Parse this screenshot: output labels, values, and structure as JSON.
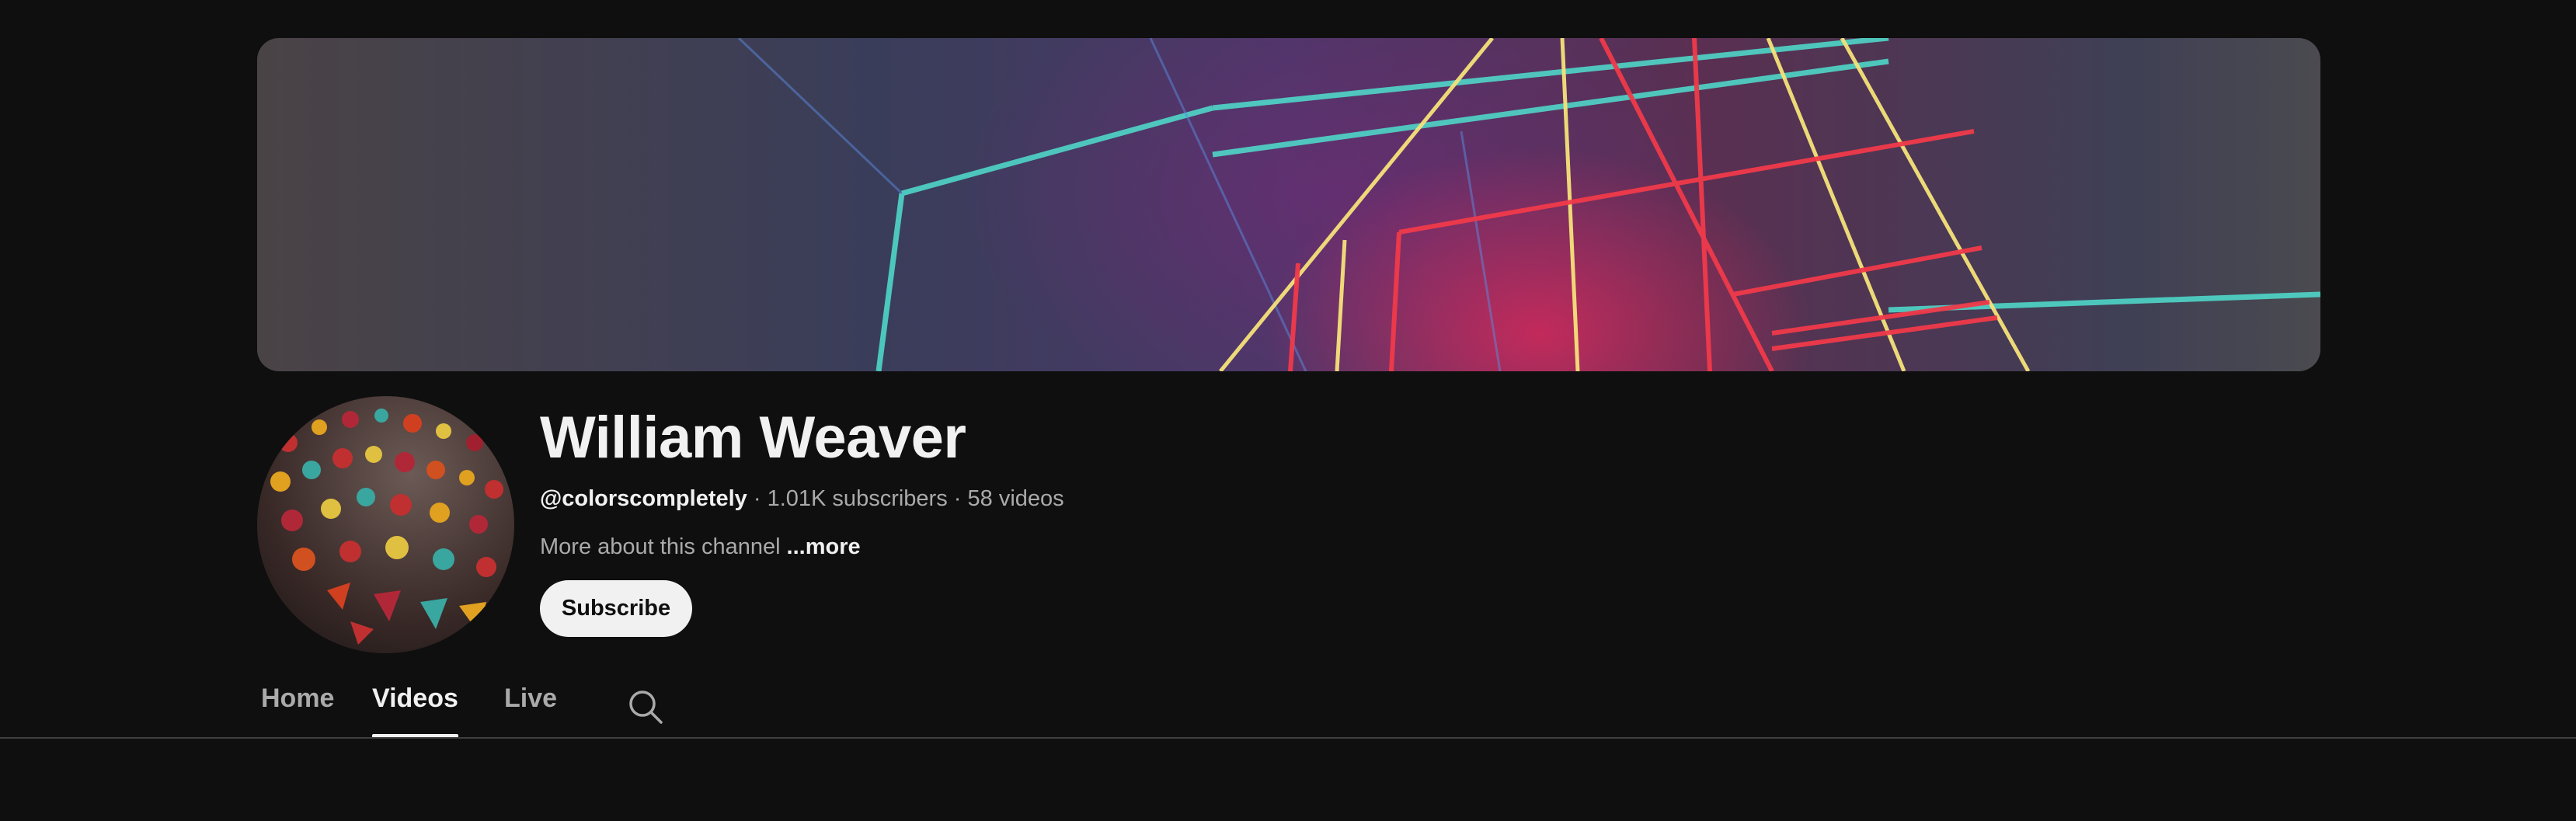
{
  "channel": {
    "name": "William Weaver",
    "handle": "@colorscompletely",
    "separator": " · ",
    "subscribers": "1.01K subscribers",
    "videos": "58 videos",
    "description": "More about this channel",
    "more_label": "...more",
    "subscribe_label": "Subscribe"
  },
  "tabs": [
    {
      "label": "Home",
      "active": false
    },
    {
      "label": "Videos",
      "active": true
    },
    {
      "label": "Live",
      "active": false
    }
  ],
  "icons": {
    "search": "search-icon"
  },
  "colors": {
    "background": "#0f0f0f",
    "text_primary": "#f1f1f1",
    "text_secondary": "#aaaaaa",
    "subscribe_bg": "#f1f1f1",
    "divider": "#3f3f3f"
  }
}
